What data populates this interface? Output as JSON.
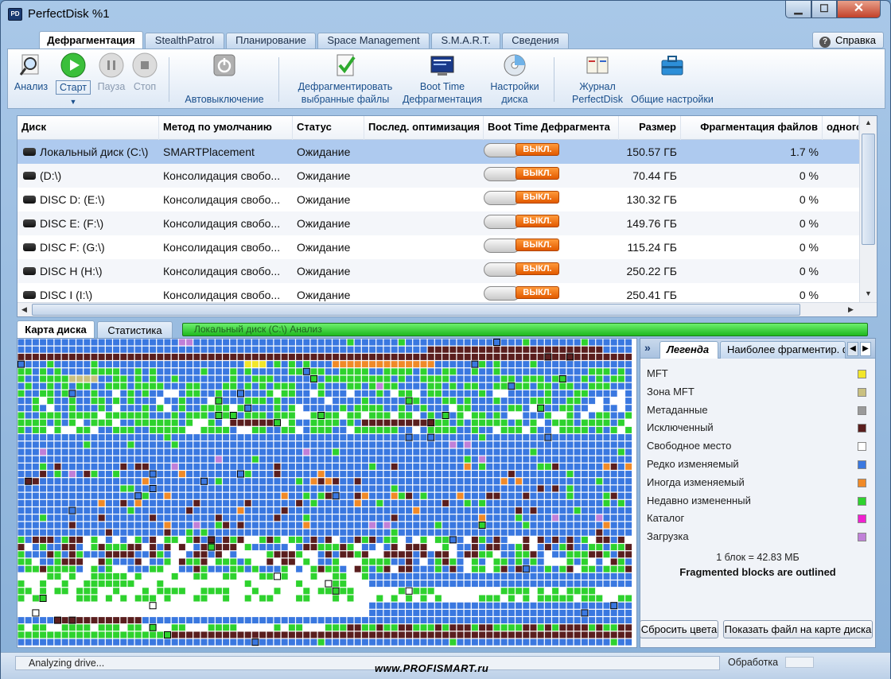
{
  "window": {
    "title": "PerfectDisk %1",
    "icon_label": "PD"
  },
  "tabs": [
    "Дефрагментация",
    "StealthPatrol",
    "Планирование",
    "Space Management",
    "S.M.A.R.T.",
    "Сведения"
  ],
  "help_label": "Справка",
  "toolbar": {
    "analyze": "Анализ",
    "start": "Старт",
    "pause": "Пауза",
    "stop": "Стоп",
    "autoshutdown": "Автовыключение",
    "defrag_files_1": "Дефрагментировать",
    "defrag_files_2": "выбранные файлы",
    "boot_time_1": "Boot Time",
    "boot_time_2": "Дефрагментация",
    "disk_settings_1": "Настройки",
    "disk_settings_2": "диска",
    "journal_1": "Журнал",
    "journal_2": "PerfectDisk",
    "general_settings": "Общие настройки"
  },
  "table": {
    "columns": [
      "Диск",
      "Метод по умолчанию",
      "Статус",
      "Послед. оптимизация",
      "Boot Time Дефрагмента",
      "Размер",
      "Фрагментация файлов",
      "одного"
    ],
    "toggle_label": "ВЫКЛ.",
    "rows": [
      {
        "disk": "Локальный диск (C:\\)",
        "method": "SMARTPlacement",
        "status": "Ожидание",
        "last": "",
        "size": "150.57 ГБ",
        "frag": "1.7 %"
      },
      {
        "disk": "(D:\\)",
        "method": "Консолидация свобо...",
        "status": "Ожидание",
        "last": "",
        "size": "70.44 ГБ",
        "frag": "0 %"
      },
      {
        "disk": "DISC D: (E:\\)",
        "method": "Консолидация свобо...",
        "status": "Ожидание",
        "last": "",
        "size": "130.32 ГБ",
        "frag": "0 %"
      },
      {
        "disk": "DISC E: (F:\\)",
        "method": "Консолидация свобо...",
        "status": "Ожидание",
        "last": "",
        "size": "149.76 ГБ",
        "frag": "0 %"
      },
      {
        "disk": "DISC F: (G:\\)",
        "method": "Консолидация свобо...",
        "status": "Ожидание",
        "last": "",
        "size": "115.24 ГБ",
        "frag": "0 %"
      },
      {
        "disk": "DISC H (H:\\)",
        "method": "Консолидация свобо...",
        "status": "Ожидание",
        "last": "",
        "size": "250.22 ГБ",
        "frag": "0 %"
      },
      {
        "disk": "DISC I (I:\\)",
        "method": "Консолидация свобо...",
        "status": "Ожидание",
        "last": "",
        "size": "250.41 ГБ",
        "frag": "0 %"
      }
    ]
  },
  "lower_tabs": {
    "map": "Карта диска",
    "stats": "Статистика"
  },
  "progress": {
    "text": "Локальный диск (C:\\)  Анализ",
    "percent": 100
  },
  "legend_panel": {
    "collapse": "»",
    "tab_legend": "Легенда",
    "tab_most_fragmented": "Наиболее фрагментир. ф",
    "items": [
      {
        "label": "MFT",
        "color": "#f2e62a"
      },
      {
        "label": "Зона MFT",
        "color": "#c9c080"
      },
      {
        "label": "Метаданные",
        "color": "#9a9a9a"
      },
      {
        "label": "Исключенный",
        "color": "#5a1e1e"
      },
      {
        "label": "Свободное место",
        "color": "#ffffff"
      },
      {
        "label": "Редко изменяемый",
        "color": "#3a78e0"
      },
      {
        "label": "Иногда изменяемый",
        "color": "#f08a28"
      },
      {
        "label": "Недавно измененный",
        "color": "#2ed22e"
      },
      {
        "label": "Каталог",
        "color": "#f020d0"
      },
      {
        "label": "Загрузка",
        "color": "#c080d8"
      }
    ],
    "block_size": "1 блок = 42.83 МБ",
    "fragmented_note": "Fragmented blocks are outlined",
    "reset_colors": "Сбросить цвета",
    "show_file": "Показать файл на карте диска"
  },
  "statusbar": {
    "text": "Analyzing drive...",
    "state": "Обработка",
    "watermark": "www.PROFISMART.ru"
  },
  "colors": {
    "accent": "#1a4f8c",
    "selected_row": "#aecaef",
    "progress": "#2ed22e",
    "toggle_off": "#f06a10"
  }
}
